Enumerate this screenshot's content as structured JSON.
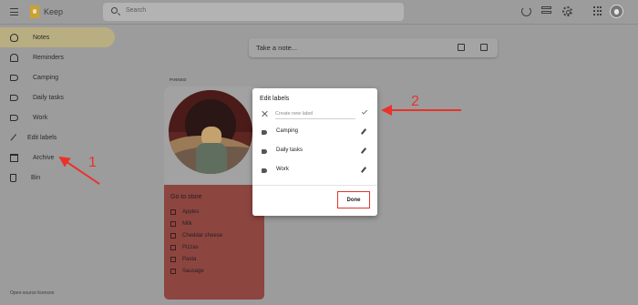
{
  "header": {
    "app_title": "Keep",
    "search_placeholder": "Search"
  },
  "sidebar": {
    "items": [
      {
        "label": "Notes",
        "icon": "lightbulb-icon"
      },
      {
        "label": "Reminders",
        "icon": "bell-icon"
      },
      {
        "label": "Camping",
        "icon": "label-icon"
      },
      {
        "label": "Daily tasks",
        "icon": "label-icon"
      },
      {
        "label": "Work",
        "icon": "label-icon"
      },
      {
        "label": "Edit labels",
        "icon": "pencil-icon"
      },
      {
        "label": "Archive",
        "icon": "archive-icon"
      },
      {
        "label": "Bin",
        "icon": "trash-icon"
      }
    ],
    "footer": "Open-source licences"
  },
  "main": {
    "take_note_placeholder": "Take a note...",
    "pinned_label": "PINNED",
    "note": {
      "title": "Go to store",
      "items": [
        "Apples",
        "Milk",
        "Cheddar cheese",
        "Pizzas",
        "Pasta",
        "Sausage"
      ]
    }
  },
  "dialog": {
    "title": "Edit labels",
    "new_label_placeholder": "Create new label",
    "labels": [
      "Camping",
      "Daily tasks",
      "Work"
    ],
    "done_label": "Done"
  },
  "annotations": {
    "num1": "1",
    "num2": "2",
    "color": "#e8332b"
  }
}
